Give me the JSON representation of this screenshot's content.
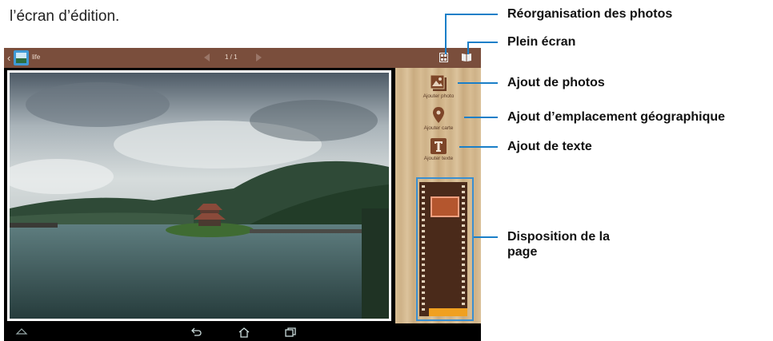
{
  "caption": "l’écran d’édition.",
  "app": {
    "album_title": "life",
    "page_indicator": "1 / 1",
    "colors": {
      "topbar": "#7a4e3c",
      "wood": "#d3b68c",
      "film": "#4a2a1a",
      "callout_line": "#1a7fc8"
    }
  },
  "tools": {
    "add_photo": "Ajouter photo",
    "add_map": "Ajouter carte",
    "add_text": "Ajouter texte"
  },
  "callouts": {
    "reorder": "Réorganisation des photos",
    "fullscreen": "Plein écran",
    "add_photos": "Ajout de photos",
    "add_location": "Ajout d’emplacement géographique",
    "add_text": "Ajout de texte",
    "layout_line1": "Disposition de la",
    "layout_line2": "page"
  },
  "icons": [
    "back-chevron-icon",
    "album-icon",
    "prev-page-icon",
    "next-page-icon",
    "reorder-icon",
    "fullscreen-icon",
    "add-photo-icon",
    "map-pin-icon",
    "text-icon",
    "back-icon",
    "home-icon",
    "recent-apps-icon",
    "collapse-icon"
  ]
}
